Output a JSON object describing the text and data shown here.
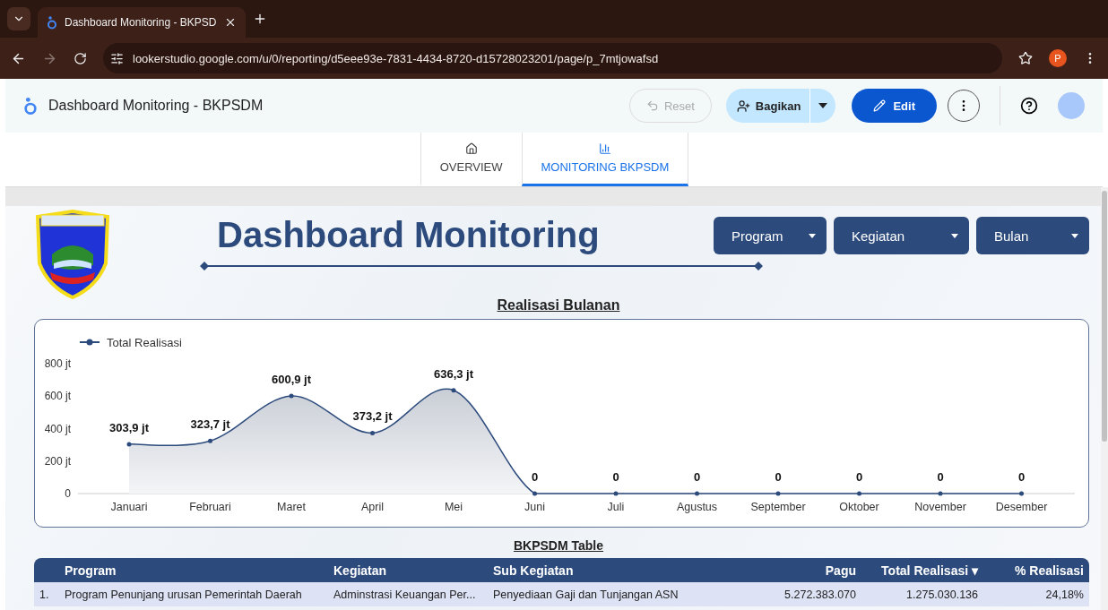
{
  "browser": {
    "tab_title": "Dashboard Monitoring - BKPSD",
    "url": "lookerstudio.google.com/u/0/reporting/d5eee93e-7831-4434-8720-d15728023201/page/p_7mtjowafsd",
    "profile_initial": "P"
  },
  "header": {
    "title": "Dashboard Monitoring - BKPSDM",
    "reset": {
      "label": "Reset",
      "disabled": true
    },
    "share": "Bagikan",
    "edit": "Edit"
  },
  "pages": [
    {
      "label": "OVERVIEW",
      "kind": "home",
      "selected": false
    },
    {
      "label": "MONITORING BKPSDM",
      "kind": "chart",
      "selected": true
    }
  ],
  "report": {
    "title": "Dashboard Monitoring",
    "filters": [
      "Program",
      "Kegiatan",
      "Bulan"
    ],
    "chart_title": "Realisasi Bulanan",
    "chart_data": {
      "type": "line",
      "categories": [
        "Januari",
        "Februari",
        "Maret",
        "April",
        "Mei",
        "Juni",
        "Juli",
        "Agustus",
        "September",
        "Oktober",
        "November",
        "Desember"
      ],
      "series": [
        {
          "name": "Total Realisasi",
          "color": "#2c4a7c",
          "values": [
            304,
            324,
            601,
            373,
            636,
            0,
            0,
            0,
            0,
            0,
            0,
            0
          ]
        }
      ],
      "ylim": [
        0,
        800
      ],
      "yticks": [
        {
          "value": 0,
          "label": "0"
        },
        {
          "value": 200,
          "label": "200 jt"
        },
        {
          "value": 400,
          "label": "400 jt"
        },
        {
          "value": 600,
          "label": "600 jt"
        },
        {
          "value": 800,
          "label": "800 jt"
        }
      ],
      "value_labels": [
        "303,9 jt",
        "323,7 jt",
        "600,9 jt",
        "373,2 jt",
        "636,3 jt",
        "0",
        "0",
        "0",
        "0",
        "0",
        "0",
        "0"
      ]
    },
    "table_title": "BKPSDM Table",
    "table": {
      "sort_indicator": "▾",
      "columns": [
        "",
        "Program",
        "Kegiatan",
        "Sub Kegiatan",
        "Pagu",
        "Total Realisasi",
        "% Realisasi"
      ],
      "rows": [
        [
          "1.",
          "Program Penunjang urusan Pemerintah Daerah",
          "Adminstrasi Keuangan Per...",
          "Penyediaan Gaji dan Tunjangan ASN",
          "5.272.383.070",
          "1.275.030.136",
          "24,18%"
        ]
      ]
    }
  }
}
